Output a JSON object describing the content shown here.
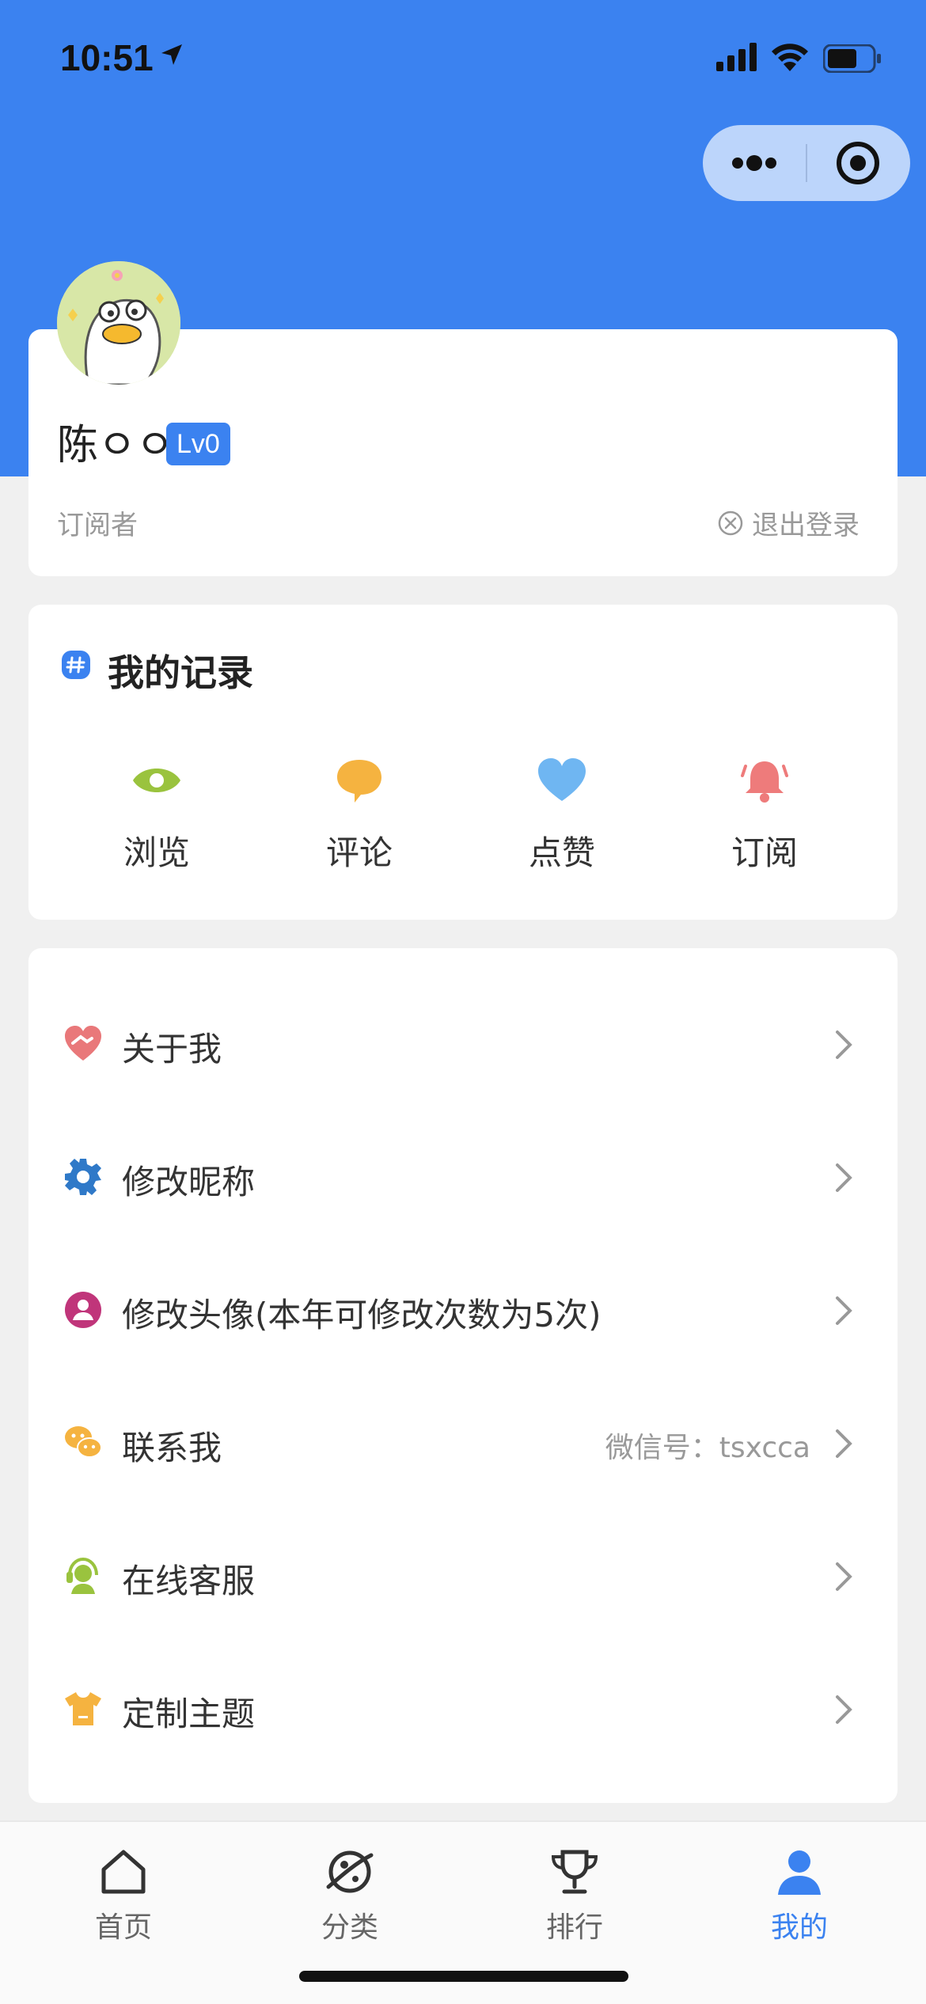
{
  "status_bar": {
    "time": "10:51"
  },
  "profile": {
    "username": "陈ㅇㅇ",
    "level": "Lv0",
    "role": "订阅者",
    "logout_label": "退出登录"
  },
  "records": {
    "title": "我的记录",
    "items": [
      {
        "label": "浏览",
        "icon": "eye-icon",
        "color": "#9ac33e"
      },
      {
        "label": "评论",
        "icon": "comment-icon",
        "color": "#f5b340"
      },
      {
        "label": "点赞",
        "icon": "heart-icon",
        "color": "#6fb6f2"
      },
      {
        "label": "订阅",
        "icon": "bell-icon",
        "color": "#ee7b7b"
      }
    ]
  },
  "menu": {
    "items": [
      {
        "label": "关于我",
        "icon": "handshake-heart-icon",
        "color": "#e9787a"
      },
      {
        "label": "修改昵称",
        "icon": "gear-icon",
        "color": "#2f79c8"
      },
      {
        "label": "修改头像(本年可修改次数为5次)",
        "icon": "user-circle-icon",
        "color": "#c0357a"
      },
      {
        "label": "联系我",
        "icon": "wechat-icon",
        "color": "#f5b340",
        "extra": "微信号：tsxcca"
      },
      {
        "label": "在线客服",
        "icon": "headset-icon",
        "color": "#9ac33e"
      },
      {
        "label": "定制主题",
        "icon": "tshirt-icon",
        "color": "#f5b340"
      }
    ]
  },
  "tabs": [
    {
      "label": "首页",
      "icon": "home-icon",
      "active": false
    },
    {
      "label": "分类",
      "icon": "planet-icon",
      "active": false
    },
    {
      "label": "排行",
      "icon": "trophy-icon",
      "active": false
    },
    {
      "label": "我的",
      "icon": "user-icon",
      "active": true
    }
  ],
  "colors": {
    "accent": "#3b82f0",
    "background": "#f0f0f0"
  }
}
